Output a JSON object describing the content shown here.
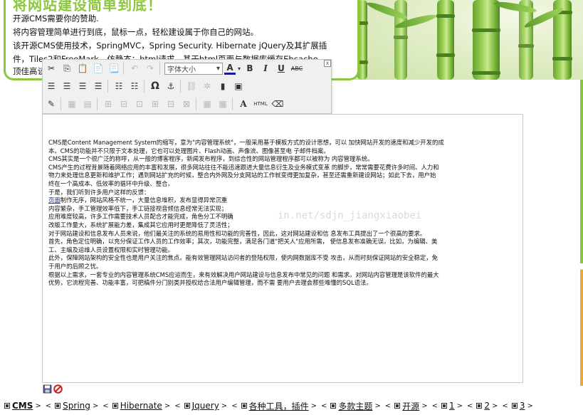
{
  "banner": {
    "title": "将网站建设简单到底！",
    "lines": [
      "开源CMS需要你的赞助.",
      "将内容管理简单进行到底，鼠标一点，轻松建设属于你自己的网站。",
      "该开源CMS使用技术，SpringMVC，Spring Security. Hibernate jQuery及其扩展插",
      "件，Tiles2和FreeMark，仿静态：html请求，基于html页面与数据库缓存Ehcache",
      "顶佳高谈"
    ]
  },
  "toolbar": {
    "font_size_label": "字体大小",
    "font_size_arrow": "▾",
    "close_label": "x",
    "row1": [
      {
        "name": "cut-icon",
        "glyph": "✂",
        "dim": false
      },
      {
        "name": "copy-icon",
        "glyph": "⎘",
        "dim": false
      },
      {
        "name": "paste-icon",
        "glyph": "📋",
        "dim": false
      },
      {
        "name": "paste-text-icon",
        "glyph": "📄",
        "dim": false
      },
      {
        "name": "paste-word-icon",
        "glyph": "📃",
        "dim": false
      },
      {
        "name": "undo-icon",
        "glyph": "↶",
        "dim": true
      },
      {
        "name": "redo-icon",
        "glyph": "↷",
        "dim": true
      }
    ],
    "row1b": [
      {
        "name": "font-color-icon",
        "glyph": "A",
        "dim": false
      },
      {
        "name": "bold-icon",
        "glyph": "B",
        "dim": false
      },
      {
        "name": "italic-icon",
        "glyph": "I",
        "dim": false
      },
      {
        "name": "underline-icon",
        "glyph": "U",
        "dim": false
      },
      {
        "name": "strikethrough-icon",
        "glyph": "ABC",
        "dim": false
      }
    ],
    "row2": [
      {
        "name": "align-left-icon",
        "glyph": "☰",
        "dim": false
      },
      {
        "name": "align-center-icon",
        "glyph": "☰",
        "dim": false
      },
      {
        "name": "align-right-icon",
        "glyph": "☰",
        "dim": false
      },
      {
        "name": "align-justify-icon",
        "glyph": "☰",
        "dim": false
      },
      {
        "name": "bullet-list-icon",
        "glyph": "☷",
        "dim": false
      },
      {
        "name": "numbered-list-icon",
        "glyph": "☷",
        "dim": false
      },
      {
        "name": "special-char-icon",
        "glyph": "Ω",
        "dim": false
      },
      {
        "name": "anchor-icon",
        "glyph": "⚓",
        "dim": false
      },
      {
        "name": "link-icon",
        "glyph": "⛓",
        "dim": true
      },
      {
        "name": "unlink-icon",
        "glyph": "✲",
        "dim": true
      },
      {
        "name": "media-icon",
        "glyph": "▮",
        "dim": false
      },
      {
        "name": "image-icon",
        "glyph": "▣",
        "dim": false
      }
    ],
    "row3": [
      {
        "name": "edit-source-icon",
        "glyph": "✎",
        "dim": false
      },
      {
        "name": "table-icon",
        "glyph": "▦",
        "dim": true
      },
      {
        "name": "table-props-icon",
        "glyph": "▤",
        "dim": true
      },
      {
        "name": "insert-row-icon",
        "glyph": "⊞",
        "dim": true
      },
      {
        "name": "delete-row-icon",
        "glyph": "⊟",
        "dim": true
      },
      {
        "name": "merge-cells-icon",
        "glyph": "⊡",
        "dim": true
      },
      {
        "name": "insert-col-icon",
        "glyph": "⊞",
        "dim": true
      },
      {
        "name": "delete-col-icon",
        "glyph": "⊟",
        "dim": true
      },
      {
        "name": "split-cell-icon",
        "glyph": "⊠",
        "dim": true
      },
      {
        "name": "grid-icon",
        "glyph": "▦",
        "dim": true
      },
      {
        "name": "grid2-icon",
        "glyph": "▦",
        "dim": true
      },
      {
        "name": "font-style-icon",
        "glyph": "A",
        "dim": false
      },
      {
        "name": "html-icon",
        "glyph": "HTML",
        "dim": false
      },
      {
        "name": "eraser-icon",
        "glyph": "⌫",
        "dim": false
      }
    ]
  },
  "editor": {
    "watermark": "in.net/sdjn_jiangxiaobei",
    "lines": [
      "CMS是Content Management System的缩写，意为\"内容管理系统\"，一般采用基于模板方式的设计思想，可以 加快网站开发的速度和减少开发的成",
      "本。CMS的功能并不只限于文本处理，它也可以处理图片、Flash动画、声像流、图像甚至电 子邮件档案。",
      "CMS其实是一个很广泛的称呼，从一般的博客程序，新闻发布程序，到综合性的网站管理程序都可以被称为 内容管理系统。",
      "CMS产生的过程背景随着网络应用的丰富和发展，很多网站往往不能迅速跟进大量信息衍生及业务模式变革 的脚步，常常需要花费许多时间、人力和",
      "物力来处理信息更新和维护工作；遇到网站扩充的时候，整合内外网及分支网站的工作就变得更加复杂，甚至还需重新建设网站；如此下去，用户始",
      "终在一个高成本、低效率的循环中升级、整合。",
      "于是，我们听到许多用户这样的反馈：",
      "制作无序，网站风格不统一，大量信息堆积，发布显得异常沉重",
      "内容繁杂，手工管理效率低下，手工链接视音频信息经常无法实现；",
      "应用难度较高，许多工作需要技术人员配合才能完成，角色分工不明确",
      "改版工作量大，系统扩展能力差，集成其它应用时更是降低了灵活性；",
      "对于网站建设和信息发布人员来说，他们最关注的系统的易用性和功能的完善性，因此，这对网站建设和信 息发布工具提出了一个很高的要求。",
      "首先，角色定位明确，以充分保证工作人员的工作效率；其次，功能完整，满足各门道\"把关人\"应用所需， 使信息发布准确无误。比如，为编辑、美",
      "工、主编及运维人员设置权限和实时管理功能。",
      "此外，保障网站架构的安全性也是用户关注的焦点。能有效管理网站访问者的登陆权限，使内网数据库不受 攻击，从而时刻保证网站的安全稳定，免",
      "于用户的后顾之忧。",
      "根据以上需求，一套专业的内容管理系统CMS应运而生，来有效解决用户网站建设与信息发布中常见的问题 和需求。对网站内容管理是该软件的最大",
      "优势，它流程完善、功能丰富，可把稿件分门别类并授权给合法用户编辑管理，而不需 要用户去理会那些难懂的SQL语法。"
    ],
    "link_word": "页面"
  },
  "nav": [
    {
      "label": "CMS",
      "bold": true
    },
    {
      "label": "Spring",
      "bold": false
    },
    {
      "label": "Hibernate",
      "bold": false
    },
    {
      "label": "Jquery",
      "bold": false
    },
    {
      "label": "各种工具，插件",
      "bold": false
    },
    {
      "label": "多款主题",
      "bold": false
    },
    {
      "label": "开源",
      "bold": false
    },
    {
      "label": "1",
      "bold": false
    },
    {
      "label": "2",
      "bold": false
    },
    {
      "label": "3",
      "bold": false
    }
  ],
  "colors": {
    "accent_green": "#8cc63f",
    "link_blue": "#1a33b8",
    "edge_orange": "#e9a93d"
  }
}
